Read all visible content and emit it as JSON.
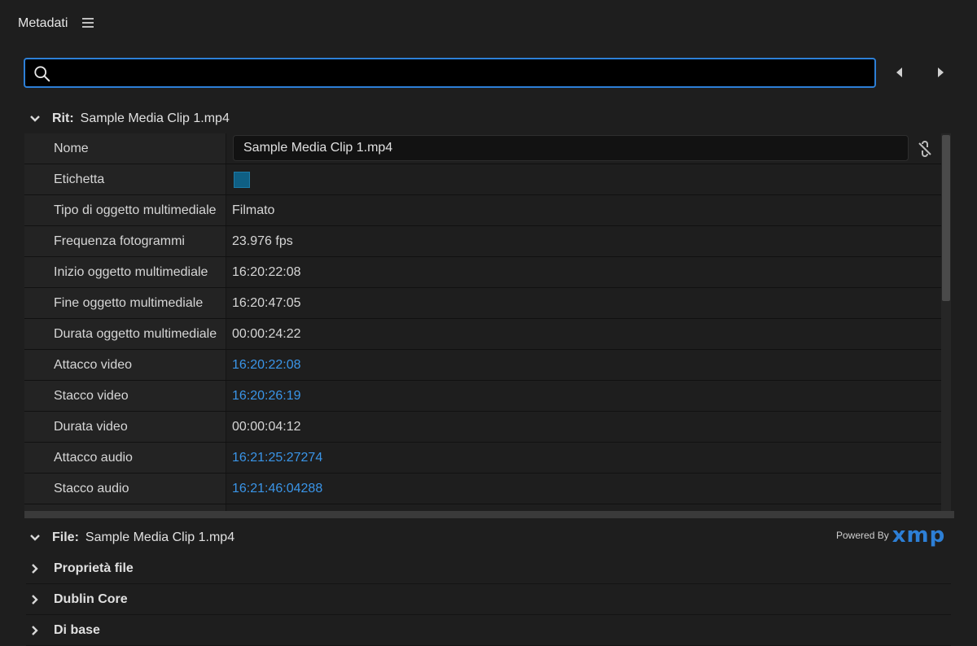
{
  "panel": {
    "title": "Metadati"
  },
  "search": {
    "value": "",
    "placeholder": ""
  },
  "clip_section": {
    "prefix": "Rit:",
    "name": "Sample Media Clip 1.mp4"
  },
  "rows": [
    {
      "label": "Nome",
      "value": "Sample Media Clip 1.mp4",
      "kind": "input"
    },
    {
      "label": "Etichetta",
      "value": "",
      "kind": "swatch"
    },
    {
      "label": "Tipo di oggetto multimediale",
      "value": "Filmato",
      "kind": "text"
    },
    {
      "label": "Frequenza fotogrammi",
      "value": "23.976 fps",
      "kind": "text"
    },
    {
      "label": "Inizio oggetto multimediale",
      "value": "16:20:22:08",
      "kind": "text"
    },
    {
      "label": "Fine oggetto multimediale",
      "value": "16:20:47:05",
      "kind": "text"
    },
    {
      "label": "Durata oggetto multimediale",
      "value": "00:00:24:22",
      "kind": "text"
    },
    {
      "label": "Attacco video",
      "value": "16:20:22:08",
      "kind": "link"
    },
    {
      "label": "Stacco video",
      "value": "16:20:26:19",
      "kind": "link"
    },
    {
      "label": "Durata video",
      "value": "00:00:04:12",
      "kind": "text"
    },
    {
      "label": "Attacco audio",
      "value": "16:21:25:27274",
      "kind": "link"
    },
    {
      "label": "Stacco audio",
      "value": "16:21:46:04288",
      "kind": "link"
    }
  ],
  "file_section": {
    "prefix": "File:",
    "name": "Sample Media Clip 1.mp4"
  },
  "powered_by": {
    "label": "Powered By",
    "brand": "xmp"
  },
  "subsections": [
    {
      "label": "Proprietà file"
    },
    {
      "label": "Dublin Core"
    },
    {
      "label": "Di base"
    }
  ],
  "colors": {
    "accent": "#2d7fd6",
    "link": "#3a95e8",
    "label_swatch": "#0f5f84"
  },
  "icons": [
    "menu-icon",
    "search-icon",
    "chevron-left-icon",
    "chevron-right-icon",
    "chevron-down-icon",
    "chevron-right-icon",
    "unlink-icon"
  ]
}
